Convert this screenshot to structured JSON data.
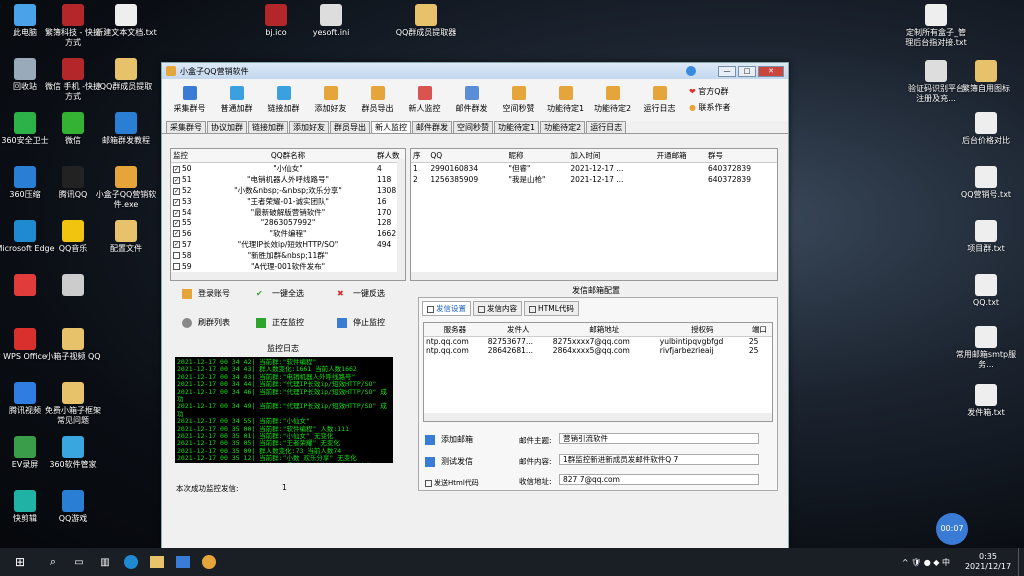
{
  "desktop_icons_left": [
    {
      "label": "此电脑",
      "color": "#4aa3e8"
    },
    {
      "label": "回收站",
      "color": "#9ab"
    },
    {
      "label": "360安全卫士",
      "color": "#2db24a"
    },
    {
      "label": "360压缩",
      "color": "#2a7fd4"
    },
    {
      "label": "Microsoft Edge",
      "color": "#1f8ad2"
    },
    {
      "label": "",
      "color": "#e23b3b"
    },
    {
      "label": "WPS Office",
      "color": "#d9302e"
    },
    {
      "label": "腾讯视频",
      "color": "#2f7de1"
    },
    {
      "label": "EV录屏",
      "color": "#3a9d4a"
    },
    {
      "label": "快剪辑",
      "color": "#20b3a5"
    }
  ],
  "desktop_icons_col2": [
    {
      "label": "繁簿科技 - 快捷方式",
      "color": "#b3262a"
    },
    {
      "label": "微信 手机 -快捷方式",
      "color": "#b3262a"
    },
    {
      "label": "微信",
      "color": "#34b233"
    },
    {
      "label": "腾讯QQ",
      "color": "#222"
    },
    {
      "label": "QQ音乐",
      "color": "#f1c40f"
    },
    {
      "label": "",
      "color": "#ccc"
    },
    {
      "label": "小箱子视频 QQ",
      "color": "#e8c26a"
    },
    {
      "label": "免费小箱子框架常见问题",
      "color": "#e8c26a"
    },
    {
      "label": "360软件管家",
      "color": "#3aa6df"
    },
    {
      "label": "QQ游戏",
      "color": "#2a7fd4"
    }
  ],
  "desktop_icons_col3": [
    {
      "label": "新建文本文档.txt",
      "color": "#eee"
    },
    {
      "label": "QQ群成员提取",
      "color": "#e8c26a"
    },
    {
      "label": "邮箱群发教程",
      "color": "#2a7fd4"
    },
    {
      "label": "小盒子QQ营销软件.exe",
      "color": "#e6a53a"
    },
    {
      "label": "配置文件",
      "color": "#e8c26a"
    }
  ],
  "desktop_icons_top": [
    {
      "label": "bj.ico",
      "color": "#b3262a"
    },
    {
      "label": "yesoft.ini",
      "color": "#ddd"
    },
    {
      "label": "QQ群成员提取器",
      "color": "#e8c26a"
    }
  ],
  "desktop_icons_right": [
    {
      "label": "定制所有盒子_管理后台指对接.txt",
      "color": "#eee"
    },
    {
      "label": "验证码识别平台注册及充...",
      "color": "#ddd"
    },
    {
      "label": "繁簿自用图标",
      "color": "#e8c26a"
    },
    {
      "label": "后台价格对比",
      "color": "#eee"
    },
    {
      "label": "QQ营销号.txt",
      "color": "#eee"
    },
    {
      "label": "项目群.txt",
      "color": "#eee"
    },
    {
      "label": "QQ.txt",
      "color": "#eee"
    },
    {
      "label": "常用邮箱smtp服务...",
      "color": "#eee"
    },
    {
      "label": "发件箱.txt",
      "color": "#eee"
    }
  ],
  "window": {
    "title": "小盒子QQ营销软件",
    "minimize": "—",
    "maximize": "□",
    "close": "✕"
  },
  "toolbar": [
    {
      "label": "采集群号",
      "color": "#3a7bd5",
      "icon": "search-icon"
    },
    {
      "label": "普通加群",
      "color": "#3aa0e0",
      "icon": "group-icon"
    },
    {
      "label": "链接加群",
      "color": "#3aa0e0",
      "icon": "link-icon"
    },
    {
      "label": "添加好友",
      "color": "#e6a53a",
      "icon": "friend-icon"
    },
    {
      "label": "群员导出",
      "color": "#e6a53a",
      "icon": "export-icon"
    },
    {
      "label": "新人监控",
      "color": "#d9534f",
      "icon": "monitor-icon"
    },
    {
      "label": "邮件群发",
      "color": "#5a8fd8",
      "icon": "mail-icon"
    },
    {
      "label": "空间秒赞",
      "color": "#e6a53a",
      "icon": "like-icon"
    },
    {
      "label": "功能待定1",
      "color": "#e6a53a",
      "icon": "star-icon"
    },
    {
      "label": "功能待定2",
      "color": "#e6a53a",
      "icon": "star-icon"
    },
    {
      "label": "运行日志",
      "color": "#e6a53a",
      "icon": "log-icon"
    }
  ],
  "side_links": {
    "official": "官方Q群",
    "contact": "联系作者"
  },
  "tabs": [
    "采集群号",
    "协议加群",
    "链接加群",
    "添加好友",
    "群员导出",
    "新人监控",
    "邮件群发",
    "空间秒赞",
    "功能待定1",
    "功能待定2",
    "运行日志"
  ],
  "active_tab": 5,
  "monitor_table": {
    "headers": [
      "监控",
      "QQ群名称",
      "群人数"
    ],
    "rows": [
      {
        "checked": true,
        "id": "50",
        "name": "\"小仙女\"",
        "count": "4"
      },
      {
        "checked": true,
        "id": "51",
        "name": "\"电销机器人外呼线路号\"",
        "count": "118"
      },
      {
        "checked": true,
        "id": "52",
        "name": "\"小数&nbsp;-&nbsp;欢乐分享\"",
        "count": "1308"
      },
      {
        "checked": true,
        "id": "53",
        "name": "\"王者荣耀-01-诚实团队\"",
        "count": "16"
      },
      {
        "checked": true,
        "id": "54",
        "name": "\"最新破解版营销软件\"",
        "count": "170"
      },
      {
        "checked": true,
        "id": "55",
        "name": "\"2863057992\"",
        "count": "128"
      },
      {
        "checked": true,
        "id": "56",
        "name": "\"软件编程\"",
        "count": "1662"
      },
      {
        "checked": true,
        "id": "57",
        "name": "\"代理IP长效ip/短效HTTP/SO\"",
        "count": "494"
      },
      {
        "checked": false,
        "id": "58",
        "name": "\"新胜加群&nbsp;11群\"",
        "count": ""
      },
      {
        "checked": false,
        "id": "59",
        "name": "\"A代理-001软件发布\"",
        "count": ""
      }
    ]
  },
  "newbie_table": {
    "headers": [
      "序",
      "QQ",
      "昵称",
      "加入时间",
      "开通邮箱",
      "群号"
    ],
    "rows": [
      {
        "no": "1",
        "qq": "2990160834",
        "nick": "\"但睿\"",
        "time": "2021-12-17 ...",
        "mail": "",
        "group": "640372839"
      },
      {
        "no": "2",
        "qq": "1256385909",
        "nick": "\"我是山枪\"",
        "time": "2021-12-17 ...",
        "mail": "",
        "group": "640372839"
      }
    ]
  },
  "actions": {
    "login": "登录账号",
    "select_all": "一键全选",
    "invert": "一键反选",
    "refresh": "刷群列表",
    "monitoring": "正在监控",
    "stop": "停止监控"
  },
  "log": {
    "title": "监控日志",
    "lines": [
      "2021-12-17 00 34 42| 当前群:\"软件编程\"",
      "2021-12-17 00 34 43| 群人数变化:1661 当前人数1662",
      "2021-12-17 00 34 43| 当前群:\"电销机器人外呼线路号\"",
      "2021-12-17 00 34 44| 当前群:\"代理IP长效ip/短效HTTP/SO\"",
      "2021-12-17 00 34 46| 当前群:\"代理IP长效ip/短效HTTP/SO\" 成功",
      "2021-12-17 00 34 49| 当前群:\"代理IP长效ip/短效HTTP/SO\" 成功",
      "2021-12-17 00 34 55| 当前群:\"小仙女\"",
      "2021-12-17 00 35 00| 当前群:\"软件编程\" 人数:111",
      "2021-12-17 00 35 01| 当前群:\"小仙女\" 无变化",
      "2021-12-17 00 35 05| 当前群:\"王者荣耀\" 无变化",
      "2021-12-17 00 35 09| 群人数变化:73 当前人数74",
      "2021-12-17 00 35 12| 当前群:\"小数 欢乐分享\" 无变化",
      "2021-12-17 00 35 12| 当前群:\"最新破解版营销软件\" 无变化"
    ]
  },
  "status": {
    "label": "本次成功监控发信:",
    "value": "1"
  },
  "mail_config": {
    "title": "发信邮箱配置",
    "tabs": [
      "发信设置",
      "发信内容",
      "HTML代码"
    ],
    "headers": [
      "服务器",
      "发件人",
      "邮箱地址",
      "授权码",
      "端口"
    ],
    "rows": [
      {
        "server": "ntp.qq.com",
        "sender": "82753677...",
        "email": "8275xxxx7@qq.com",
        "code": "yulbintipqvgbfgd",
        "port": "25"
      },
      {
        "server": "ntp.qq.com",
        "sender": "28642681...",
        "email": "2864xxxx5@qq.com",
        "code": "rivfjarbezrieaij",
        "port": "25"
      }
    ],
    "add_mail": "添加邮箱",
    "test_send": "测试发信",
    "html_checkbox": "发送Html代码",
    "subject_label": "邮件主题:",
    "subject_value": "营销引流软件",
    "content_label": "邮件内容:",
    "content_value": "1群监控新进新成员发邮件软件Q        7",
    "receiver_label": "收信地址:",
    "receiver_value": "827        7@qq.com"
  },
  "taskbar": {
    "time": "0:35",
    "date": "2021/12/17"
  },
  "recording_badge": "00:07"
}
